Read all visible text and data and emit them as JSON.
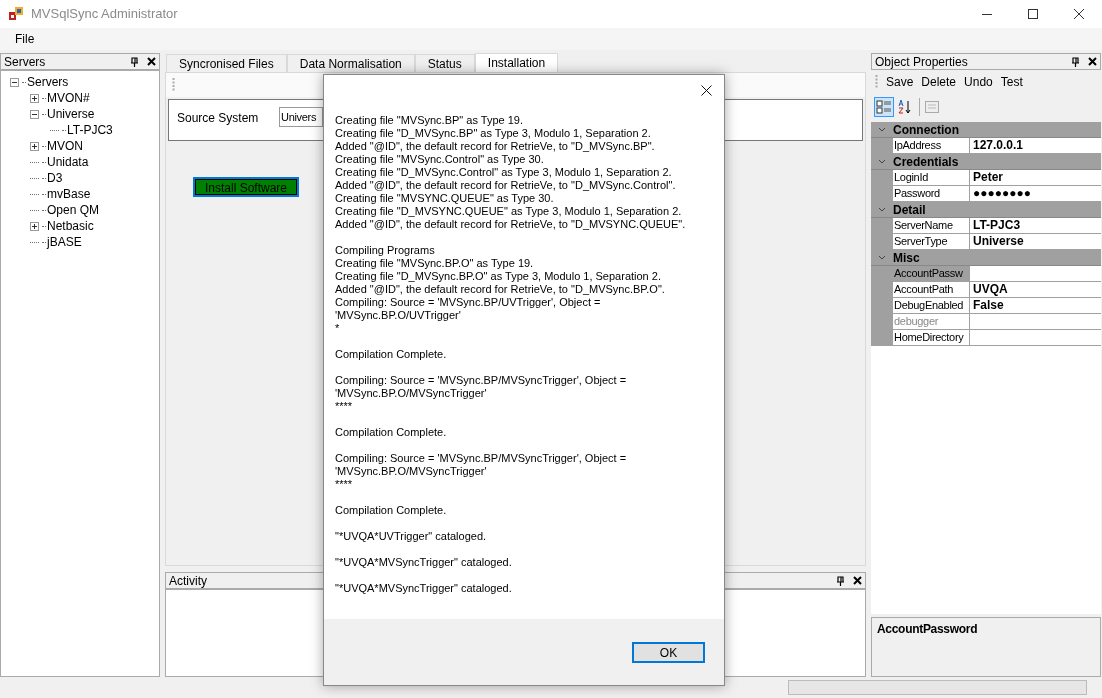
{
  "window": {
    "title": "MVSqlSync Administrator"
  },
  "menu": [
    "File"
  ],
  "servers_panel": {
    "title": "Servers",
    "tree": [
      {
        "label": "Servers",
        "expanded": true,
        "children": [
          {
            "label": "MVON#",
            "expanded": false
          },
          {
            "label": "Universe",
            "expanded": true,
            "children": [
              {
                "label": "LT-PJC3"
              }
            ]
          },
          {
            "label": "MVON",
            "expanded": false
          },
          {
            "label": "Unidata"
          },
          {
            "label": "D3"
          },
          {
            "label": "mvBase"
          },
          {
            "label": "Open QM"
          },
          {
            "label": "Netbasic",
            "expanded": false
          },
          {
            "label": "jBASE"
          }
        ]
      }
    ]
  },
  "tabs": [
    {
      "label": "Syncronised Files",
      "selected": false
    },
    {
      "label": "Data Normalisation",
      "selected": false
    },
    {
      "label": "Status",
      "selected": false
    },
    {
      "label": "Installation",
      "selected": true
    }
  ],
  "installation": {
    "source_label": "Source System",
    "source_value": "Univers",
    "install_button": "Install Software"
  },
  "activity_panel": {
    "title": "Activity"
  },
  "properties_panel": {
    "title": "Object Properties",
    "actions": [
      "Save",
      "Delete",
      "Undo",
      "Test"
    ],
    "view_buttons": [
      {
        "kind": "categorized",
        "selected": true
      },
      {
        "kind": "alphabetical",
        "selected": false
      }
    ],
    "categories": [
      {
        "name": "Connection",
        "expanded": true,
        "properties": [
          {
            "name": "IpAddress",
            "value": "127.0.0.1",
            "selected": false,
            "disabled": false
          }
        ]
      },
      {
        "name": "Credentials",
        "expanded": true,
        "properties": [
          {
            "name": "LoginId",
            "value": "Peter",
            "selected": false,
            "disabled": false
          },
          {
            "name": "Password",
            "value": "●●●●●●●●",
            "selected": false,
            "disabled": false
          }
        ]
      },
      {
        "name": "Detail",
        "expanded": true,
        "properties": [
          {
            "name": "ServerName",
            "value": "LT-PJC3",
            "selected": false,
            "disabled": false
          },
          {
            "name": "ServerType",
            "value": "Universe",
            "selected": false,
            "disabled": false
          }
        ]
      },
      {
        "name": "Misc",
        "expanded": true,
        "properties": [
          {
            "name": "AccountPassw",
            "selected": true,
            "disabled": false
          },
          {
            "name": "AccountPath",
            "value": "UVQA",
            "selected": false,
            "disabled": false
          },
          {
            "name": "DebugEnabled",
            "value": "False",
            "selected": false,
            "disabled": false
          },
          {
            "name": "debugger",
            "selected": false,
            "disabled": true
          },
          {
            "name": "HomeDirectory",
            "selected": false,
            "disabled": false
          }
        ]
      }
    ],
    "description": {
      "title": "AccountPassword"
    }
  },
  "status_bar": {
    "progress": {
      "level": 0
    }
  },
  "dialog": {
    "paragraphs": [
      [
        "Creating file \"MVSync.BP\" as Type 19.",
        "Creating file \"D_MVSync.BP\" as Type 3, Modulo 1, Separation 2.",
        "Added \"@ID\", the default record for RetrieVe, to \"D_MVSync.BP\".",
        "Creating file \"MVSync.Control\" as Type 30.",
        "Creating file \"D_MVSync.Control\" as Type 3, Modulo 1, Separation 2.",
        "Added \"@ID\", the default record for RetrieVe, to \"D_MVSync.Control\".",
        "Creating file \"MVSYNC.QUEUE\" as Type 30.",
        "Creating file \"D_MVSYNC.QUEUE\" as Type 3, Modulo 1, Separation 2.",
        "Added \"@ID\", the default record for RetrieVe, to \"D_MVSYNC.QUEUE\"."
      ],
      [
        "Compiling Programs",
        "Creating file \"MVSync.BP.O\" as Type 19.",
        "Creating file \"D_MVSync.BP.O\" as Type 3, Modulo 1, Separation 2.",
        "Added \"@ID\", the default record for RetrieVe, to \"D_MVSync.BP.O\".",
        "Compiling: Source = 'MVSync.BP/UVTrigger', Object =",
        "'MVSync.BP.O/UVTrigger'",
        "*"
      ],
      [
        "Compilation Complete."
      ],
      [
        "Compiling: Source = 'MVSync.BP/MVSyncTrigger', Object =",
        "'MVSync.BP.O/MVSyncTrigger'",
        "****"
      ],
      [
        "Compilation Complete."
      ],
      [
        "Compiling: Source = 'MVSync.BP/MVSyncTrigger', Object =",
        "'MVSync.BP.O/MVSyncTrigger'",
        "****"
      ],
      [
        "Compilation Complete."
      ],
      [
        "\"*UVQA*UVTrigger\" cataloged."
      ],
      [
        "\"*UVQA*MVSyncTrigger\" cataloged."
      ],
      [
        "\"*UVQA*MVSyncTrigger\" cataloged."
      ]
    ],
    "ok_button": "OK"
  }
}
